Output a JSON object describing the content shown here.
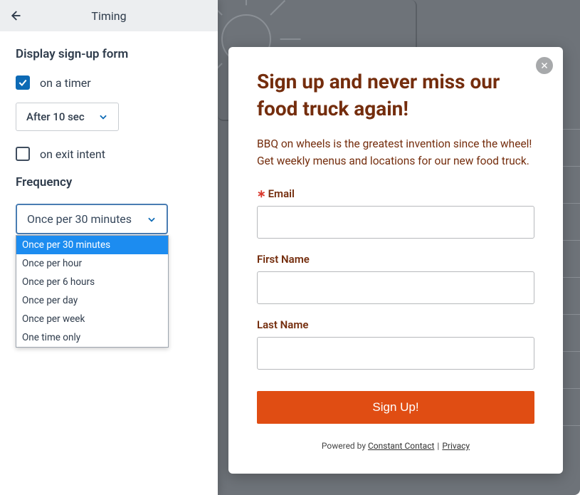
{
  "sidebar": {
    "title": "Timing",
    "display_label": "Display sign-up form",
    "timer": {
      "label": "on a timer",
      "checked": true,
      "value": "After 10 sec"
    },
    "exit": {
      "label": "on exit intent",
      "checked": false
    },
    "freq_label": "Frequency",
    "freq_value": "Once per 30 minutes",
    "freq_options": [
      "Once per 30 minutes",
      "Once per hour",
      "Once per 6 hours",
      "Once per day",
      "Once per week",
      "One time only"
    ]
  },
  "popup": {
    "title": "Sign up and never miss our food truck again!",
    "desc": "BBQ on wheels is the greatest invention since the wheel! Get weekly menus and locations for our new food truck.",
    "email_label": "Email",
    "fname_label": "First Name",
    "lname_label": "Last Name",
    "button": "Sign Up!",
    "powered_prefix": "Powered by ",
    "powered_by": "Constant Contact",
    "privacy": "Privacy"
  }
}
